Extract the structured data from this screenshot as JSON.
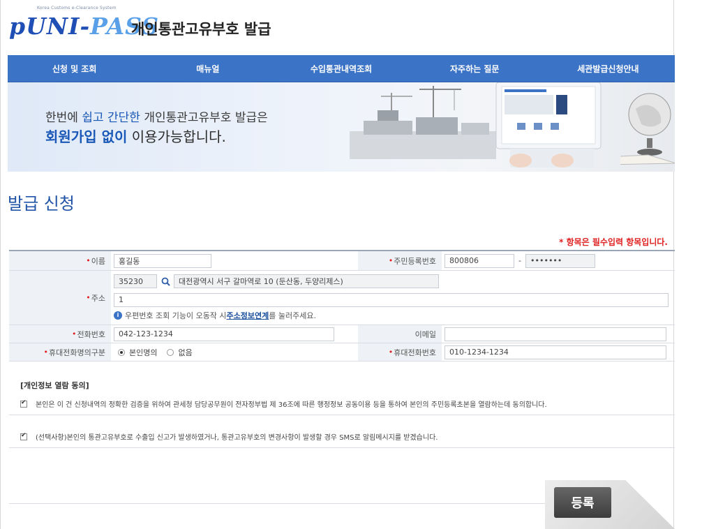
{
  "header": {
    "logo_small": "Korea Customs e-Clearance System",
    "logo_text": "pUNI-",
    "logo_text2": "PASS",
    "title": "개인통관고유부호 발급"
  },
  "nav": {
    "items": [
      {
        "label": "신청 및 조회"
      },
      {
        "label": "매뉴얼"
      },
      {
        "label": "수입통관내역조회"
      },
      {
        "label": "자주하는 질문"
      },
      {
        "label": "세관발급신청안내"
      }
    ]
  },
  "banner": {
    "line1_pre": "한번에 ",
    "line1_hl": "쉽고 간단한",
    "line1_post": " 개인통관고유부호 발급은",
    "line2_hl": "회원가입",
    "line2_bold": " 없이",
    "line2_post": " 이용가능합니다."
  },
  "page_title": "발급 신청",
  "required_note": "* 항목은 필수입력 항목입니다.",
  "form": {
    "name_label": "이름",
    "name_value": "홍길동",
    "rrn_label": "주민등록번호",
    "rrn_front": "800806",
    "rrn_dash": "-",
    "rrn_back": "•••••••",
    "addr_label": "주소",
    "zip_value": "35230",
    "addr1_value": "대전광역시 서구 갈마역로 10 (둔산동, 두양리제스)",
    "addr2_value": "1",
    "addr_note_pre": "우편번호 조회 기능이 오동작 시 ",
    "addr_note_link": "주소정보연계",
    "addr_note_post": "를 눌러주세요.",
    "phone_label": "전화번호",
    "phone_value": "042-123-1234",
    "email_label": "이메일",
    "email_value": "",
    "mobile_owner_label": "휴대전화명의구분",
    "mobile_owner_opt1": "본인명의",
    "mobile_owner_opt2": "없음",
    "mobile_label": "휴대전화번호",
    "mobile_value": "010-1234-1234"
  },
  "consent": {
    "title": "[개인정보 열람 동의]",
    "item1": "본인은 이 건 신청내역의 정확한 검증을 위하여 관세청 담당공무원이 전자정부법 제 36조에 따른 행정정보 공동이용 등을 통하여 본인의 주민등록초본을 열람하는데 동의합니다.",
    "item2": "(선택사항)본인의 통관고유부호로 수출입 신고가 발생하였거나, 통관고유부호의 변경사항이 발생할 경우 SMS로 알림메시지를 받겠습니다."
  },
  "submit_label": "등록"
}
